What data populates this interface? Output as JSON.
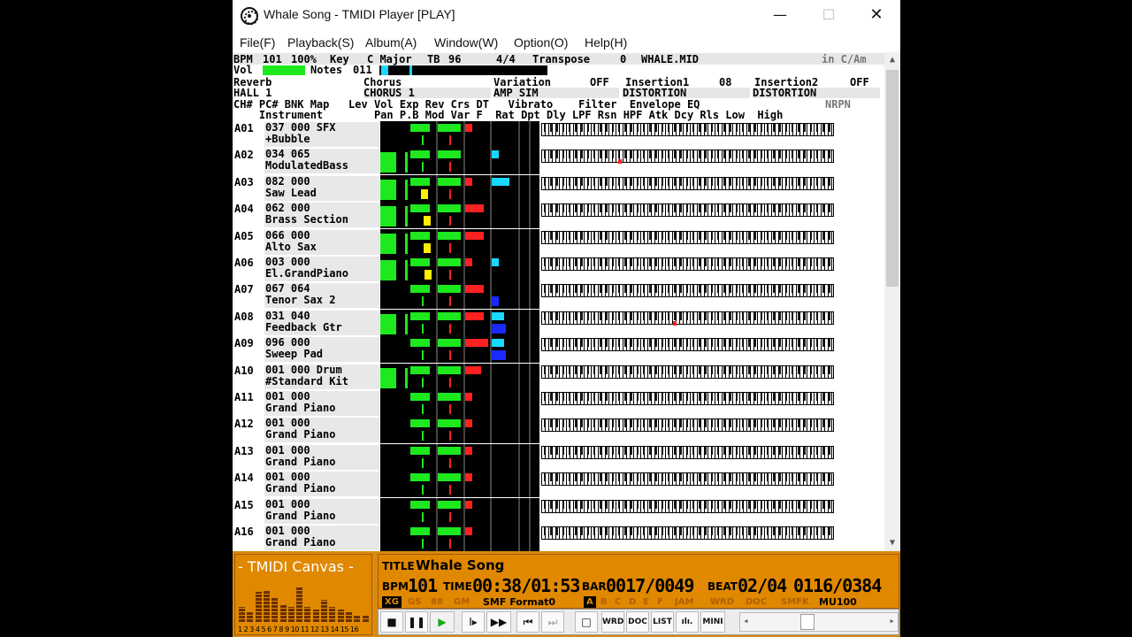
{
  "window": {
    "title": "Whale Song - TMIDI Player [PLAY]",
    "minimize": "—",
    "maximize": "☐",
    "close": "✕"
  },
  "menu": [
    "File(F)",
    "Playback(S)",
    "Album(A)",
    "Window(W)",
    "Option(O)",
    "Help(H)"
  ],
  "header": {
    "bpm_label": "BPM",
    "bpm": "101",
    "tempo_pct": "100%",
    "key_label": "Key",
    "key": "C Major",
    "tb_label": "TB",
    "tb": "96",
    "time_sig": "4/4",
    "transpose_label": "Transpose",
    "transpose": "0",
    "file": "WHALE.MID",
    "key_hint": "in C/Am",
    "vol_label": "Vol",
    "notes_label": "Notes",
    "notes": "011",
    "reverb_label": "Reverb",
    "reverb": "HALL 1",
    "chorus_label": "Chorus",
    "chorus": "CHORUS 1",
    "variation_label": "Variation",
    "variation_state": "OFF",
    "variation": "AMP SIM",
    "insertion1_label": "Insertion1",
    "insertion1_state": "08",
    "insertion1": "DISTORTION",
    "insertion2_label": "Insertion2",
    "insertion2_state": "OFF",
    "insertion2": "DISTORTION",
    "col_row1": "CH# PC# BNK Map   Lev Vol Exp Rev Crs DT   Vibrato    Filter  Envelope EQ",
    "col_row2": "    Instrument        Pan P.B Mod Var F  Rat Dpt Dly LPF Rsn HPF Atk Dcy Rls Low  High",
    "nrpn": "NRPN"
  },
  "channels": [
    {
      "id": "A01",
      "line1": "037 000 SFX",
      "line2": "+Bubble",
      "lev": 0.0,
      "vol": 0.73,
      "exp": 0.87,
      "rev": 0.3,
      "crs": "none",
      "pan": 0.55,
      "pb": 0.5,
      "mod": 0.0,
      "note": null
    },
    {
      "id": "A02",
      "line1": "034 065",
      "line2": "ModulatedBass",
      "lev": 0.9,
      "vol": 0.73,
      "exp": 0.87,
      "rev": 0.0,
      "crs": "cyan-small",
      "pan": 0.55,
      "pb": 0.5,
      "mod": 0.0,
      "note": 0.26
    },
    {
      "id": "A03",
      "line1": "082 000",
      "line2": "Saw Lead",
      "lev": 0.9,
      "vol": 0.73,
      "exp": 0.87,
      "rev": 0.3,
      "crs": "cyan",
      "pan": 0.5,
      "pb": 0.5,
      "mod": 0.0,
      "note": null
    },
    {
      "id": "A04",
      "line1": "062 000",
      "line2": "Brass Section",
      "lev": 0.9,
      "vol": 0.73,
      "exp": 0.87,
      "rev": 0.8,
      "crs": "none",
      "pan": 0.6,
      "pb": 0.5,
      "mod": 0.0,
      "note": null
    },
    {
      "id": "A05",
      "line1": "066 000",
      "line2": "Alto Sax",
      "lev": 0.9,
      "vol": 0.73,
      "exp": 0.87,
      "rev": 0.8,
      "crs": "none",
      "pan": 0.6,
      "pb": 0.5,
      "mod": 0.0,
      "note": null
    },
    {
      "id": "A06",
      "line1": "003 000",
      "line2": "El.GrandPiano",
      "lev": 0.9,
      "vol": 0.73,
      "exp": 0.87,
      "rev": 0.3,
      "crs": "cyan-small",
      "pan": 0.65,
      "pb": 0.5,
      "mod": 0.0,
      "note": null
    },
    {
      "id": "A07",
      "line1": "067 064",
      "line2": "Tenor Sax 2",
      "lev": 0.0,
      "vol": 0.73,
      "exp": 0.87,
      "rev": 0.8,
      "crs": "blue-small",
      "pan": 0.55,
      "pb": 0.5,
      "mod": 0.0,
      "note": null
    },
    {
      "id": "A08",
      "line1": "031 040",
      "line2": "Feedback Gtr",
      "lev": 0.9,
      "vol": 0.73,
      "exp": 0.87,
      "rev": 0.8,
      "crs": "cyan-blue",
      "pan": 0.55,
      "pb": 0.5,
      "mod": 0.0,
      "note": 0.45
    },
    {
      "id": "A09",
      "line1": "096 000",
      "line2": "Sweep Pad",
      "lev": 0.0,
      "vol": 0.73,
      "exp": 0.87,
      "rev": 1.0,
      "crs": "cyan-blue",
      "pan": 0.55,
      "pb": 0.5,
      "mod": 0.0,
      "note": null
    },
    {
      "id": "A10",
      "line1": "001 000 Drum",
      "line2": "#Standard Kit",
      "lev": 0.9,
      "vol": 0.73,
      "exp": 0.87,
      "rev": 0.7,
      "crs": "none",
      "pan": 0.55,
      "pb": 0.5,
      "mod": 0.0,
      "note": null
    },
    {
      "id": "A11",
      "line1": "001 000",
      "line2": "Grand Piano",
      "lev": 0.0,
      "vol": 0.73,
      "exp": 0.87,
      "rev": 0.3,
      "crs": "none",
      "pan": 0.55,
      "pb": 0.5,
      "mod": 0.0,
      "note": null
    },
    {
      "id": "A12",
      "line1": "001 000",
      "line2": "Grand Piano",
      "lev": 0.0,
      "vol": 0.73,
      "exp": 0.87,
      "rev": 0.3,
      "crs": "none",
      "pan": 0.55,
      "pb": 0.5,
      "mod": 0.0,
      "note": null
    },
    {
      "id": "A13",
      "line1": "001 000",
      "line2": "Grand Piano",
      "lev": 0.0,
      "vol": 0.73,
      "exp": 0.87,
      "rev": 0.3,
      "crs": "none",
      "pan": 0.55,
      "pb": 0.5,
      "mod": 0.0,
      "note": null
    },
    {
      "id": "A14",
      "line1": "001 000",
      "line2": "Grand Piano",
      "lev": 0.0,
      "vol": 0.73,
      "exp": 0.87,
      "rev": 0.3,
      "crs": "none",
      "pan": 0.55,
      "pb": 0.5,
      "mod": 0.0,
      "note": null
    },
    {
      "id": "A15",
      "line1": "001 000",
      "line2": "Grand Piano",
      "lev": 0.0,
      "vol": 0.73,
      "exp": 0.87,
      "rev": 0.3,
      "crs": "none",
      "pan": 0.55,
      "pb": 0.5,
      "mod": 0.0,
      "note": null
    },
    {
      "id": "A16",
      "line1": "001 000",
      "line2": "Grand Piano",
      "lev": 0.0,
      "vol": 0.73,
      "exp": 0.87,
      "rev": 0.3,
      "crs": "none",
      "pan": 0.55,
      "pb": 0.5,
      "mod": 0.0,
      "note": null
    }
  ],
  "canvas": {
    "title": "- TMIDI Canvas -",
    "numbers": "1 2 3 4 5 6 7 8 9 10 11 12 13 14 15 16",
    "levels": [
      0.3,
      0.2,
      0.6,
      0.65,
      0.5,
      0.35,
      0.3,
      0.7,
      0.3,
      0.25,
      0.45,
      0.3,
      0.25,
      0.2,
      0.15,
      0.15
    ]
  },
  "info": {
    "title_label": "TITLE",
    "title": "Whale Song",
    "bpm_label": "BPM",
    "bpm": "101",
    "time_label": "TIME",
    "time": "00:38/01:53",
    "bar_label": "BAR",
    "bar": "0017/0049",
    "beat_label": "BEAT",
    "beat": "02/04",
    "tick": "0116/0384",
    "chip_xg": "XG",
    "chip_gs": "GS",
    "chip_88": "88",
    "chip_gm": "GM",
    "format": "SMF Format0",
    "chip_a": "A",
    "chip_b": "B",
    "chip_c": "C",
    "chip_d": "D",
    "chip_e": "E",
    "chip_f": "F",
    "chip_jam": "JAM",
    "chip_wrd": "WRD",
    "chip_doc": "DOC",
    "chip_smfk": "SMFK",
    "module": "MU100"
  },
  "toolbar": {
    "stop": "■",
    "pause": "❚❚",
    "play": "▶",
    "step": "I▸",
    "ff": "▶▶",
    "prev": "⏮",
    "next": "⏭",
    "window": "□",
    "wrd": "WRD",
    "doc": "DOC",
    "list": "LIST",
    "spectrum": "ılı.",
    "mini": "MINI",
    "left": "◂",
    "right": "▸"
  },
  "colors": {
    "meter_green": "#1ee81e",
    "orange": "#e08800",
    "red": "#ff2020",
    "cyan": "#18d8ff"
  }
}
